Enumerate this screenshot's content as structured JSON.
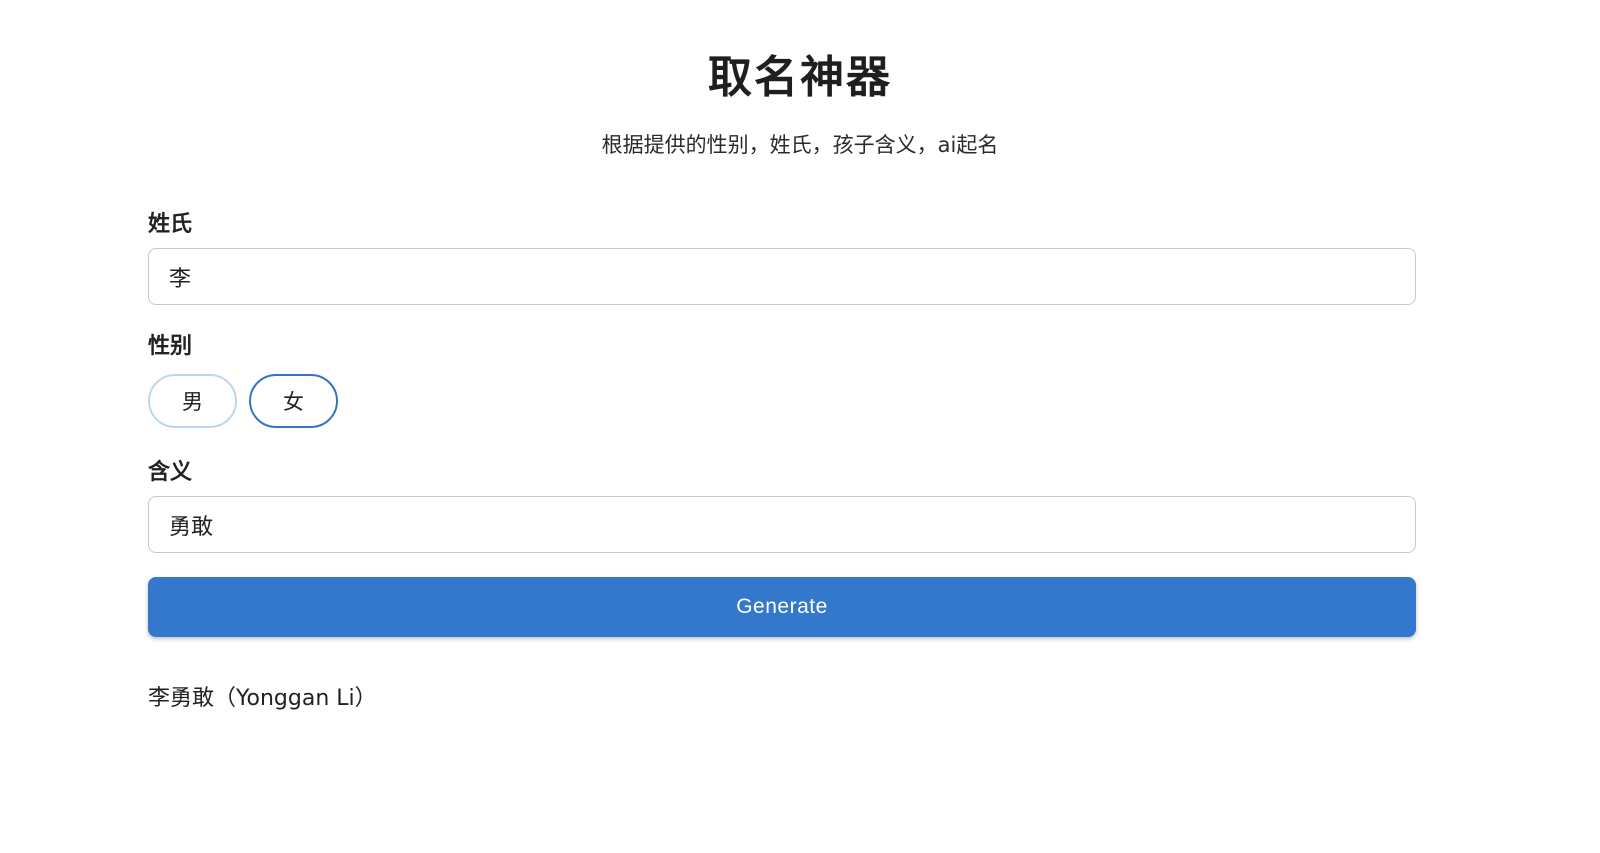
{
  "header": {
    "title": "取名神器",
    "subtitle": "根据提供的性别，姓氏，孩子含义，ai起名"
  },
  "form": {
    "surname": {
      "label": "姓氏",
      "value": "李"
    },
    "gender": {
      "label": "性别",
      "options": [
        {
          "label": "男",
          "selected": false
        },
        {
          "label": "女",
          "selected": true
        }
      ]
    },
    "meaning": {
      "label": "含义",
      "value": "勇敢"
    },
    "generate_label": "Generate"
  },
  "result": {
    "text": "李勇敢（Yonggan Li）"
  },
  "colors": {
    "accent": "#3378cd",
    "selected_border": "#3474c4",
    "unselected_border": "#bcd6ee",
    "input_border": "#c9c9c9"
  }
}
